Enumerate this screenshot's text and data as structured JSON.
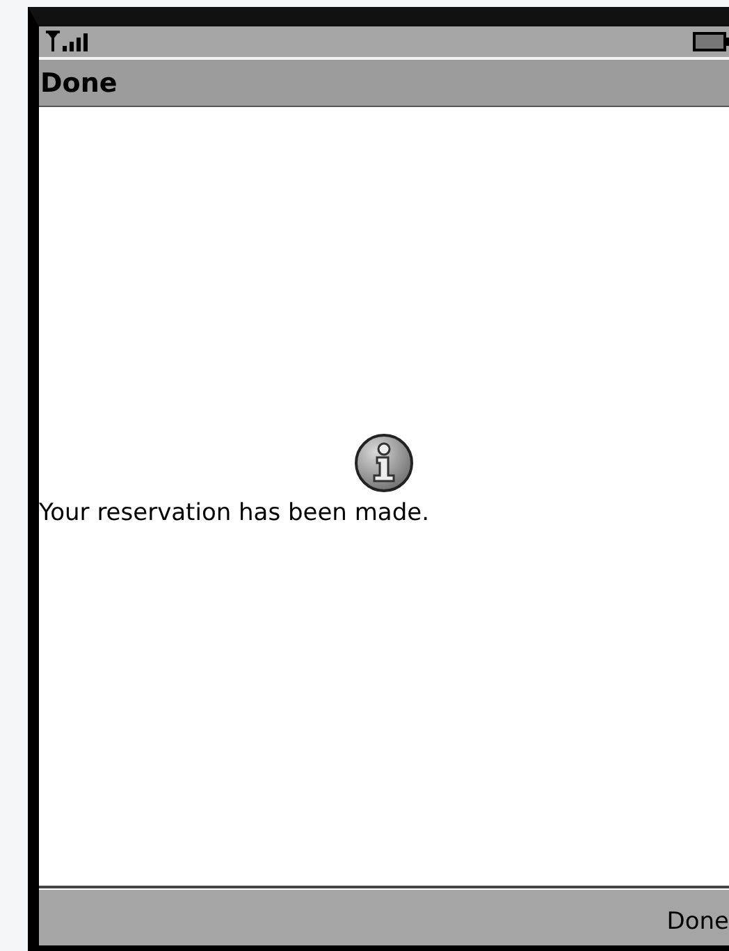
{
  "title_bar": {
    "title": "Done"
  },
  "alert": {
    "message": "Your reservation has been made."
  },
  "soft_keys": {
    "right": "Done"
  }
}
